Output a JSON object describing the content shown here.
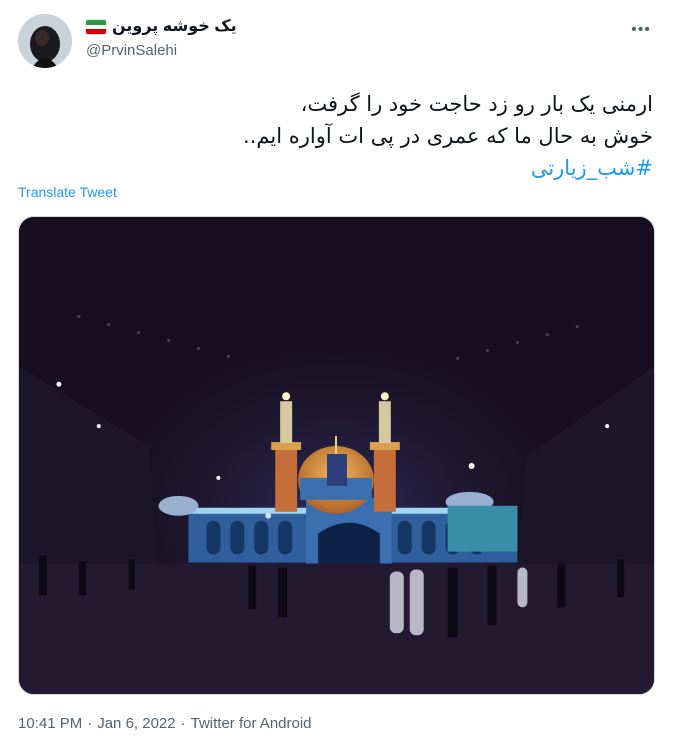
{
  "author": {
    "display_name": "یک خوشه پروین",
    "handle": "@PrvinSalehi",
    "flag_colors": [
      "#239f40",
      "#ffffff",
      "#da0000"
    ]
  },
  "icons": {
    "more": "more-dots-icon",
    "flag": "iran-flag-icon"
  },
  "tweet": {
    "line1": "ارمنی یک بار رو زد حاجت خود را گرفت،",
    "line2": "خوش به حال ما که عمری در پی ات آواره ایم..",
    "hashtag": "#شب_زیارتی",
    "translate_label": "Translate Tweet"
  },
  "meta": {
    "time": "10:41 PM",
    "date": "Jan 6, 2022",
    "source": "Twitter for Android",
    "separator": "·"
  },
  "colors": {
    "accent": "#1d9bf0",
    "secondary_text": "#536471"
  }
}
